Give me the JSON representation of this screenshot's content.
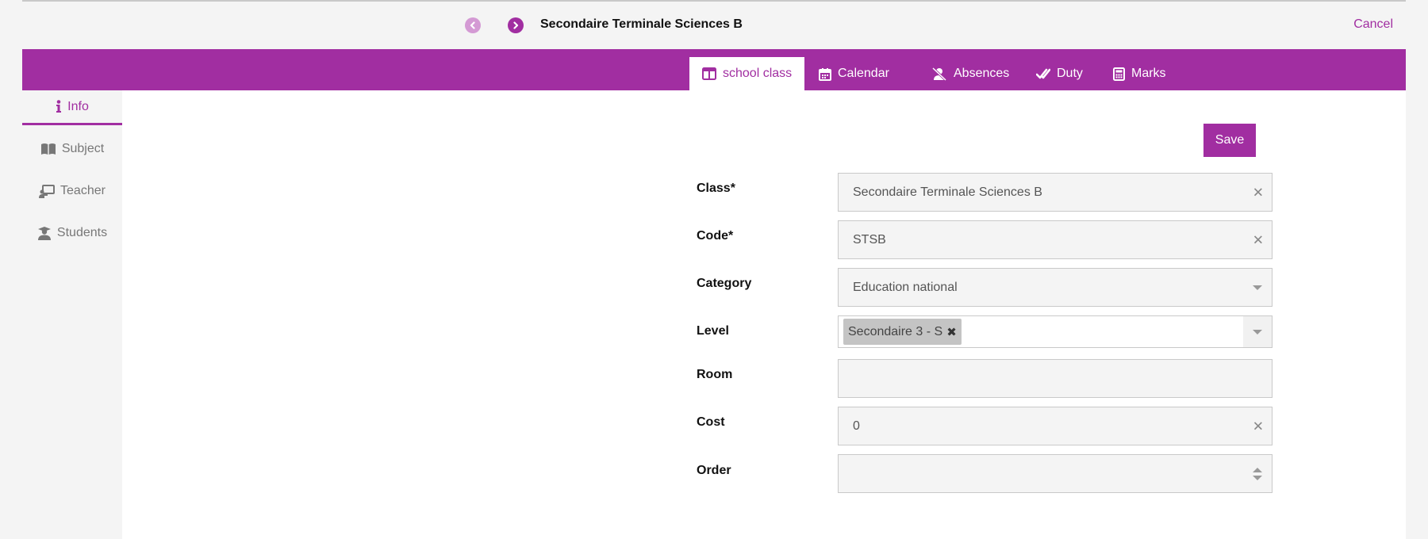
{
  "header": {
    "record_title": "Secondaire Terminale Sciences B",
    "cancel_label": "Cancel"
  },
  "tabs": [
    {
      "label": "school class",
      "icon": "columns-icon",
      "active": true
    },
    {
      "label": "Calendar",
      "icon": "calendar-icon",
      "active": false
    },
    {
      "label": "Absences",
      "icon": "user-slash-icon",
      "active": false
    },
    {
      "label": "Duty",
      "icon": "double-check-icon",
      "active": false
    },
    {
      "label": "Marks",
      "icon": "calculator-icon",
      "active": false
    }
  ],
  "sidebar": {
    "items": [
      {
        "label": "Info",
        "icon": "info-icon",
        "active": true
      },
      {
        "label": "Subject",
        "icon": "book-icon",
        "active": false
      },
      {
        "label": "Teacher",
        "icon": "chalkboard-teacher-icon",
        "active": false
      },
      {
        "label": "Students",
        "icon": "user-graduate-icon",
        "active": false
      }
    ]
  },
  "form": {
    "save_label": "Save",
    "class": {
      "label": "Class*",
      "value": "Secondaire Terminale Sciences B"
    },
    "code": {
      "label": "Code*",
      "value": "STSB"
    },
    "category": {
      "label": "Category",
      "value": "Education national"
    },
    "level": {
      "label": "Level",
      "tags": [
        "Secondaire 3 - S"
      ]
    },
    "room": {
      "label": "Room",
      "value": ""
    },
    "cost": {
      "label": "Cost",
      "value": "0"
    },
    "order": {
      "label": "Order",
      "value": ""
    }
  },
  "colors": {
    "accent": "#a12ea1",
    "accent_light": "#d49ad4",
    "background": "#f4f4f4",
    "field_bg": "#f4f4f4",
    "tag_bg": "#c4c4c4"
  }
}
